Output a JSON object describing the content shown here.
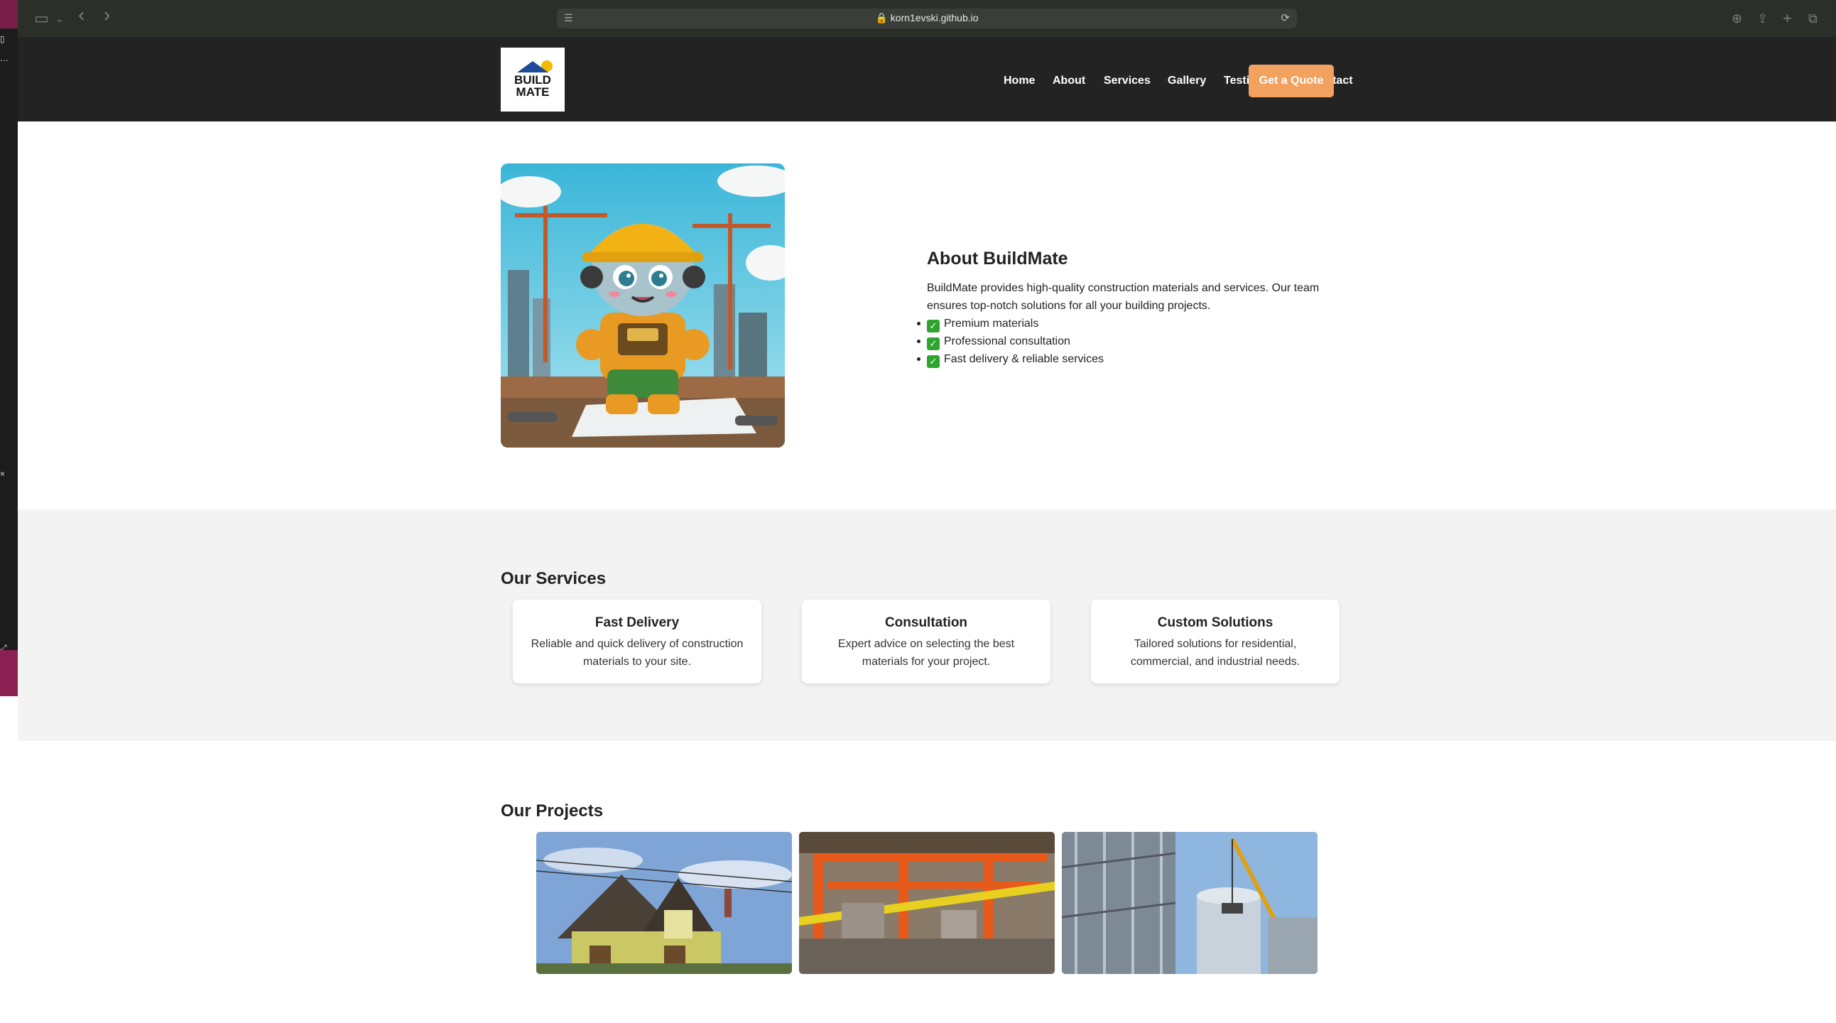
{
  "browser": {
    "url": "korn1evski.github.io",
    "sidebar_icon": "sidebar-icon",
    "back_icon": "‹",
    "forward_icon": "›"
  },
  "header": {
    "logo_line1": "BUILD",
    "logo_line2": "MATE",
    "nav": [
      "Home",
      "About",
      "Services",
      "Gallery",
      "Testimonials",
      "Contact"
    ],
    "quote_button": "Get a Quote"
  },
  "about": {
    "title": "About BuildMate",
    "description": "BuildMate provides high-quality construction materials and services. Our team ensures top-notch solutions for all your building projects.",
    "features": [
      "Premium materials",
      "Professional consultation",
      "Fast delivery & reliable services"
    ]
  },
  "services": {
    "title": "Our Services",
    "cards": [
      {
        "title": "Fast Delivery",
        "text": "Reliable and quick delivery of construction materials to your site."
      },
      {
        "title": "Consultation",
        "text": "Expert advice on selecting the best materials for your project."
      },
      {
        "title": "Custom Solutions",
        "text": "Tailored solutions for residential, commercial, and industrial needs."
      }
    ]
  },
  "projects": {
    "title": "Our Projects"
  },
  "colors": {
    "header_bg": "#232323",
    "accent": "#f2a15e",
    "section_bg": "#f3f3f3"
  }
}
